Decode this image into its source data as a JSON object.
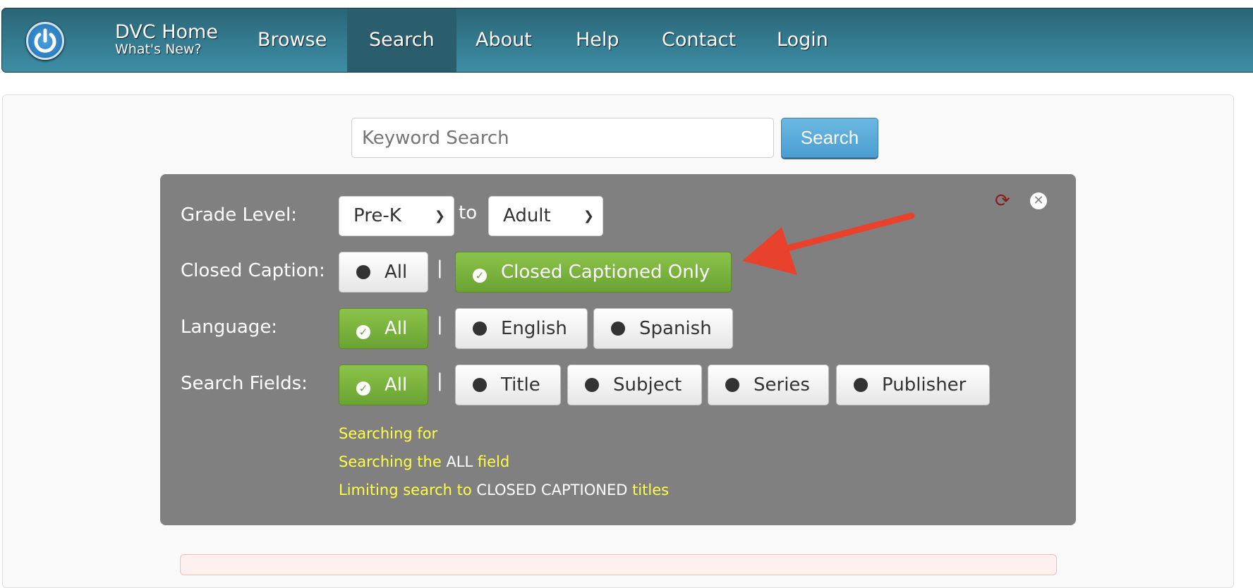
{
  "nav": {
    "home": "DVC Home",
    "whats_new": "What's New?",
    "items": [
      "Browse",
      "Search",
      "About",
      "Help",
      "Contact",
      "Login"
    ],
    "active": "Search"
  },
  "search": {
    "placeholder": "Keyword Search",
    "button": "Search"
  },
  "filters": {
    "grade_label": "Grade Level:",
    "grade_from": "Pre-K",
    "to": "to",
    "grade_to": "Adult",
    "cc_label": "Closed Caption:",
    "cc_options": [
      "All",
      "Closed Captioned Only"
    ],
    "cc_selected": "Closed Captioned Only",
    "lang_label": "Language:",
    "lang_options": [
      "All",
      "English",
      "Spanish"
    ],
    "lang_selected": "All",
    "fields_label": "Search Fields:",
    "fields_options": [
      "All",
      "Title",
      "Subject",
      "Series",
      "Publisher"
    ],
    "fields_selected": "All",
    "separator": "|"
  },
  "status": {
    "line1": "Searching for",
    "line2a": "Searching the ",
    "line2b": "ALL",
    "line2c": " field",
    "line3a": "Limiting search to ",
    "line3b": "CLOSED CAPTIONED",
    "line3c": " titles"
  },
  "colors": {
    "nav": "#2f7387",
    "panel": "#808080",
    "selected": "#7ab03f",
    "status": "#ffff44",
    "arrow": "#e8412c",
    "refresh": "#8b1a1a"
  }
}
